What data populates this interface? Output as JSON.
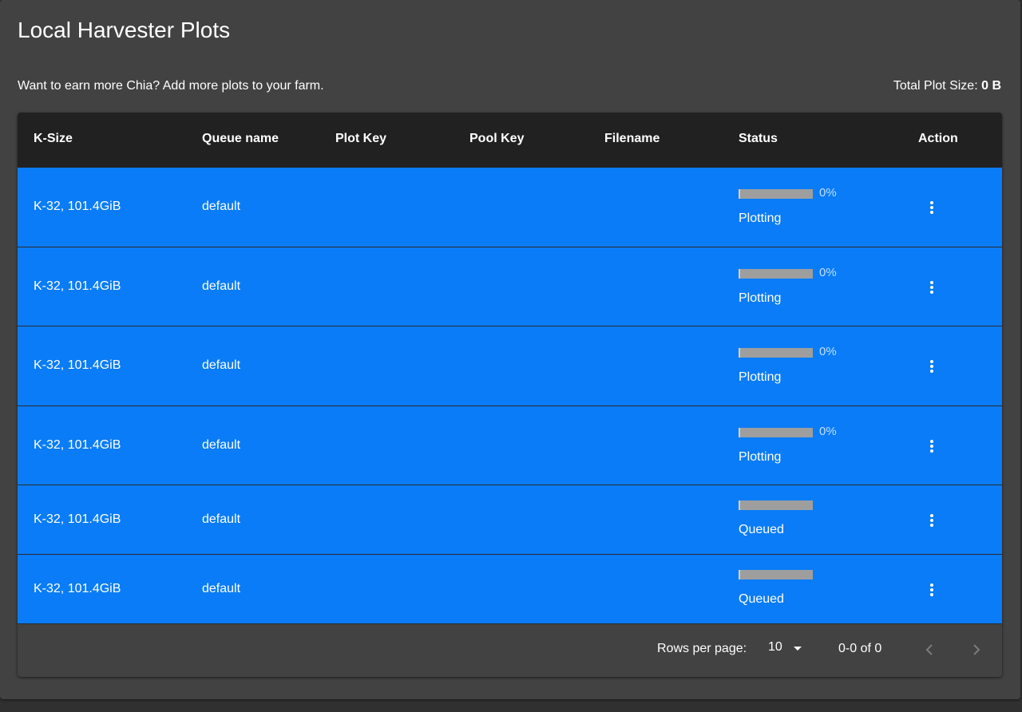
{
  "page": {
    "title": "Local Harvester Plots",
    "subtitle": "Want to earn more Chia? Add more plots to your farm.",
    "total_label": "Total Plot Size: ",
    "total_value": "0 B"
  },
  "table": {
    "columns": [
      "K-Size",
      "Queue name",
      "Plot Key",
      "Pool Key",
      "Filename",
      "Status",
      "Action"
    ],
    "rows": [
      {
        "ksize": "K-32, 101.4GiB",
        "queue": "default",
        "plot_key": "",
        "pool_key": "",
        "filename": "",
        "progress": 0,
        "progress_label": "0%",
        "status": "Plotting"
      },
      {
        "ksize": "K-32, 101.4GiB",
        "queue": "default",
        "plot_key": "",
        "pool_key": "",
        "filename": "",
        "progress": 0,
        "progress_label": "0%",
        "status": "Plotting"
      },
      {
        "ksize": "K-32, 101.4GiB",
        "queue": "default",
        "plot_key": "",
        "pool_key": "",
        "filename": "",
        "progress": 0,
        "progress_label": "0%",
        "status": "Plotting"
      },
      {
        "ksize": "K-32, 101.4GiB",
        "queue": "default",
        "plot_key": "",
        "pool_key": "",
        "filename": "",
        "progress": 0,
        "progress_label": "0%",
        "status": "Plotting"
      },
      {
        "ksize": "K-32, 101.4GiB",
        "queue": "default",
        "plot_key": "",
        "pool_key": "",
        "filename": "",
        "progress": 0,
        "progress_label": "",
        "status": "Queued"
      },
      {
        "ksize": "K-32, 101.4GiB",
        "queue": "default",
        "plot_key": "",
        "pool_key": "",
        "filename": "",
        "progress": 0,
        "progress_label": "",
        "status": "Queued"
      }
    ],
    "action_icon": "more-vert-icon"
  },
  "pagination": {
    "rows_per_page_label": "Rows per page:",
    "rows_per_page_value": "10",
    "range": "0-0 of 0",
    "prev_icon": "chevron-left-icon",
    "next_icon": "chevron-right-icon"
  },
  "colors": {
    "background": "#303030",
    "card": "#424242",
    "header": "#212121",
    "row": "#0a7cf7"
  }
}
